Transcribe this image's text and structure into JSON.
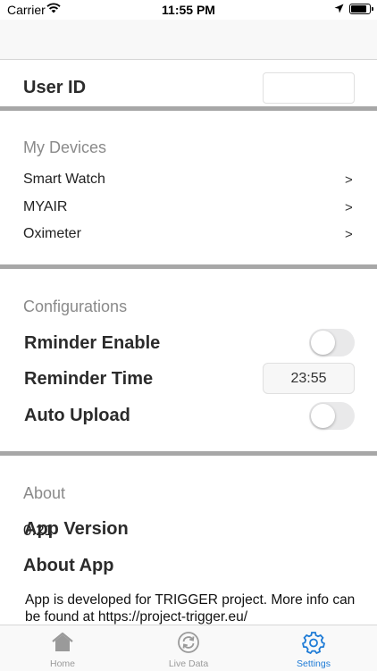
{
  "status_bar": {
    "carrier": "Carrier",
    "time": "11:55 PM"
  },
  "user_id": {
    "label": "User ID",
    "value": ""
  },
  "devices": {
    "header": "My Devices",
    "items": [
      {
        "label": "Smart Watch",
        "chevron": ">"
      },
      {
        "label": "MYAIR",
        "chevron": ">"
      },
      {
        "label": "Oximeter",
        "chevron": ">"
      }
    ]
  },
  "configurations": {
    "header": "Configurations",
    "reminder_enable": {
      "label": "Rminder Enable",
      "on": false
    },
    "reminder_time": {
      "label": "Reminder Time",
      "value": "23:55"
    },
    "auto_upload": {
      "label": "Auto Upload",
      "on": false
    }
  },
  "about": {
    "header": "About",
    "version_value": "0.21",
    "version_label": "App Version",
    "about_app_label": "About App",
    "description": "App is developed for TRIGGER project. More info can be found at https://project-trigger.eu/"
  },
  "tabbar": {
    "tabs": [
      {
        "label": "Home",
        "icon": "home-icon",
        "active": false
      },
      {
        "label": "Live Data",
        "icon": "sync-icon",
        "active": false
      },
      {
        "label": "Settings",
        "icon": "gear-icon",
        "active": true
      }
    ]
  },
  "colors": {
    "accent": "#1e7bd6",
    "separator": "#a7a7a7"
  }
}
